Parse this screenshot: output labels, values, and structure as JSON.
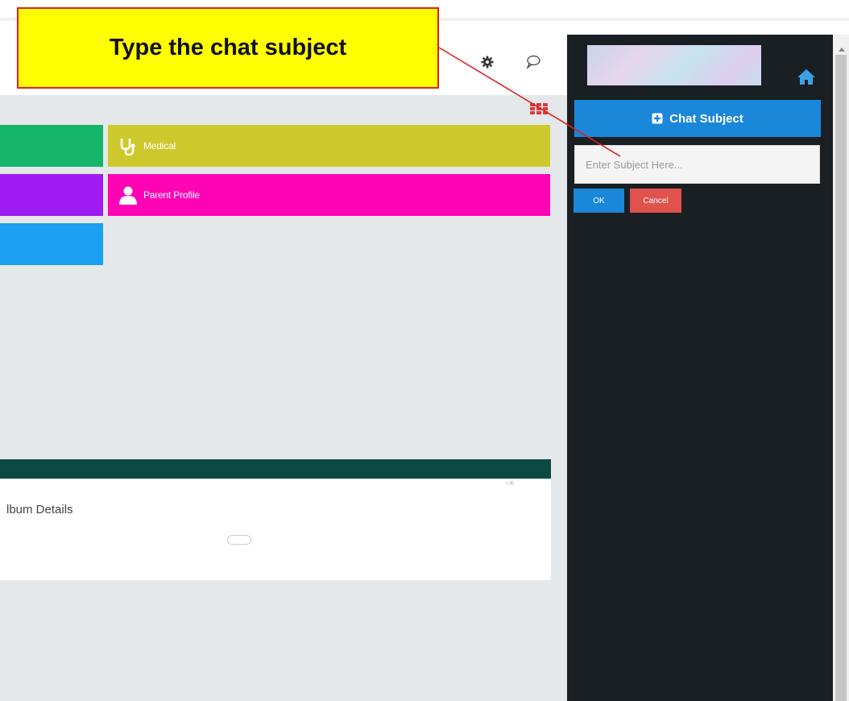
{
  "annotation": {
    "text": "Type the chat subject"
  },
  "tiles": [
    {
      "label": "",
      "color": "#15b669"
    },
    {
      "label": "Medical",
      "color": "#cdc92d",
      "icon": "stethoscope-icon"
    },
    {
      "label": "",
      "color": "#9e1cf2"
    },
    {
      "label": "Parent Profile",
      "color": "#ff04b4",
      "icon": "user-icon"
    },
    {
      "label": "",
      "color": "#1ba0f3"
    }
  ],
  "panel": {
    "title": "lbum Details",
    "controls": "◦×"
  },
  "sidebar": {
    "chat_subject_label": "Chat Subject",
    "input_placeholder": "Enter Subject Here...",
    "ok_label": "OK",
    "cancel_label": "Cancel"
  },
  "colors": {
    "sidebar_bg": "#1a1f24",
    "accent": "#1a87d8",
    "cancel": "#e0524b",
    "callout": "#ffff00",
    "callout_border": "#e02020"
  }
}
